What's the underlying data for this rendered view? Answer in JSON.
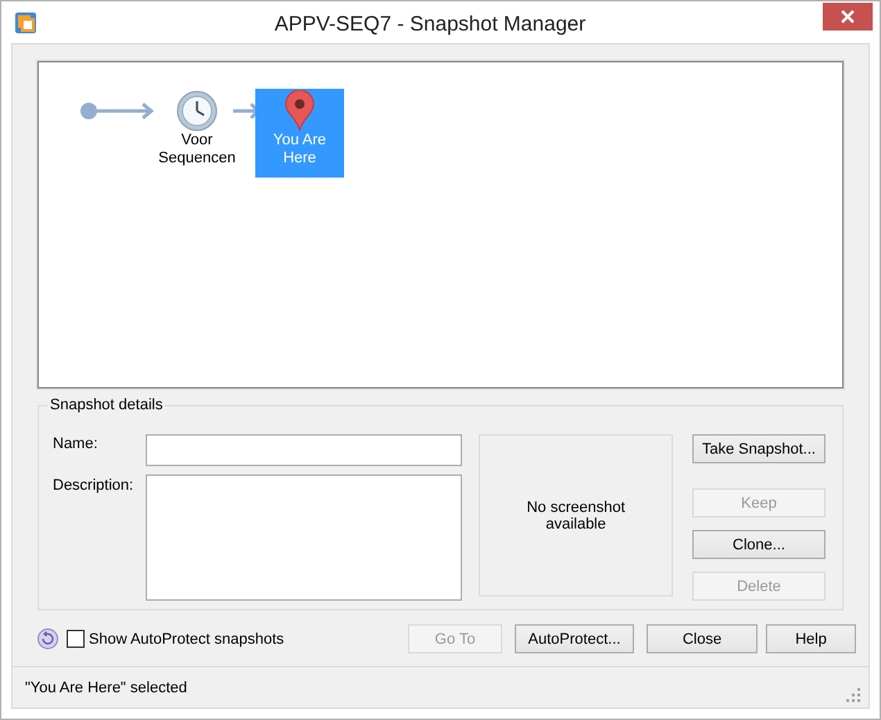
{
  "window": {
    "title": "APPV-SEQ7 - Snapshot Manager"
  },
  "diagram": {
    "nodes": [
      {
        "kind": "start"
      },
      {
        "kind": "snapshot",
        "label": "Voor Sequencen",
        "selected": false
      },
      {
        "kind": "current",
        "label": "You Are Here",
        "selected": true
      }
    ]
  },
  "details": {
    "title": "Snapshot details",
    "name_label": "Name:",
    "description_label": "Description:",
    "preview_text": "No screenshot available",
    "buttons": [
      {
        "label": "Take Snapshot...",
        "disabled": false
      },
      {
        "label": "Keep",
        "disabled": true
      },
      {
        "label": "Clone...",
        "disabled": false
      },
      {
        "label": "Delete",
        "disabled": true
      }
    ]
  },
  "autoprotect": {
    "label": "Show AutoProtect snapshots",
    "checked": false
  },
  "buttons": [
    {
      "label": "Go To",
      "disabled": true
    },
    {
      "label": "AutoProtect...",
      "disabled": false
    },
    {
      "label": "Close",
      "disabled": false
    },
    {
      "label": "Help",
      "disabled": false
    }
  ],
  "status_bar": {
    "text": "\"You Are Here\" selected"
  }
}
